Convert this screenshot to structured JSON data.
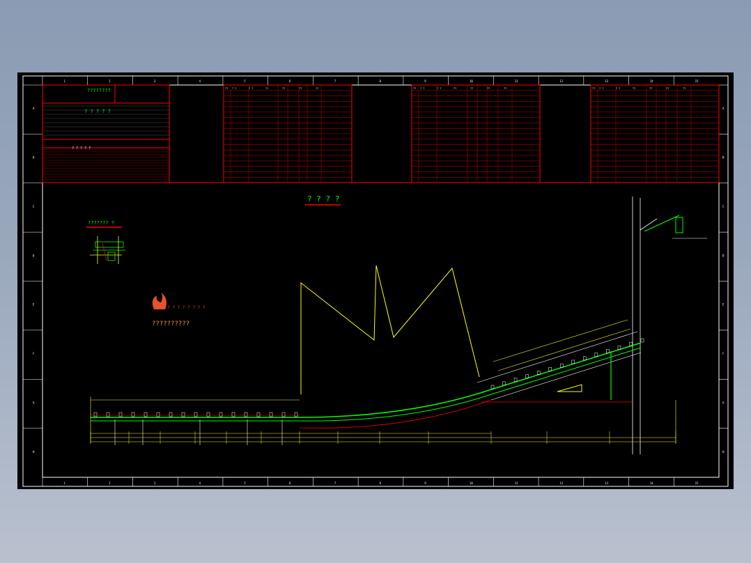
{
  "drawing": {
    "main_title": "? ? ? ?",
    "detail_title": "??????? ?",
    "watermark_text": "? ? ? ? ? ? ? ? ?",
    "logo_caption": "??????????",
    "colors": {
      "background": "#000000",
      "frame": "#ffffff",
      "table_lines": "#ff0000",
      "conveyor": "#00ff00",
      "dimension": "#ffff00",
      "table_text": "#ffffff",
      "highlight_text": "#00ff00"
    }
  },
  "border": {
    "top_labels": [
      "1",
      "2",
      "3",
      "4",
      "5",
      "6",
      "7",
      "8",
      "9",
      "10",
      "11",
      "12",
      "13",
      "14",
      "15"
    ],
    "bottom_labels": [
      "1",
      "2",
      "3",
      "4",
      "5",
      "6",
      "7",
      "8",
      "9",
      "10",
      "11",
      "12",
      "13",
      "14",
      "15"
    ],
    "side_labels": [
      "A",
      "B",
      "C",
      "D",
      "E",
      "F",
      "G",
      "H"
    ]
  },
  "tables": {
    "title_block": {
      "heading": "????????",
      "sub_heading": "? ? ? ? ?",
      "section_heading": "? ? ? ? ?"
    },
    "parts_list_1": {
      "header": [
        "??",
        "?  ?",
        "?  ?",
        "??",
        "??",
        "??",
        "??"
      ]
    },
    "parts_list_2": {
      "header": [
        "??",
        "?  ?",
        "?  ?",
        "??",
        "??",
        "??",
        "??"
      ]
    },
    "parts_list_3": {
      "header": [
        "??",
        "?  ?",
        "?  ?",
        "??",
        "??",
        "??",
        "??"
      ]
    }
  }
}
